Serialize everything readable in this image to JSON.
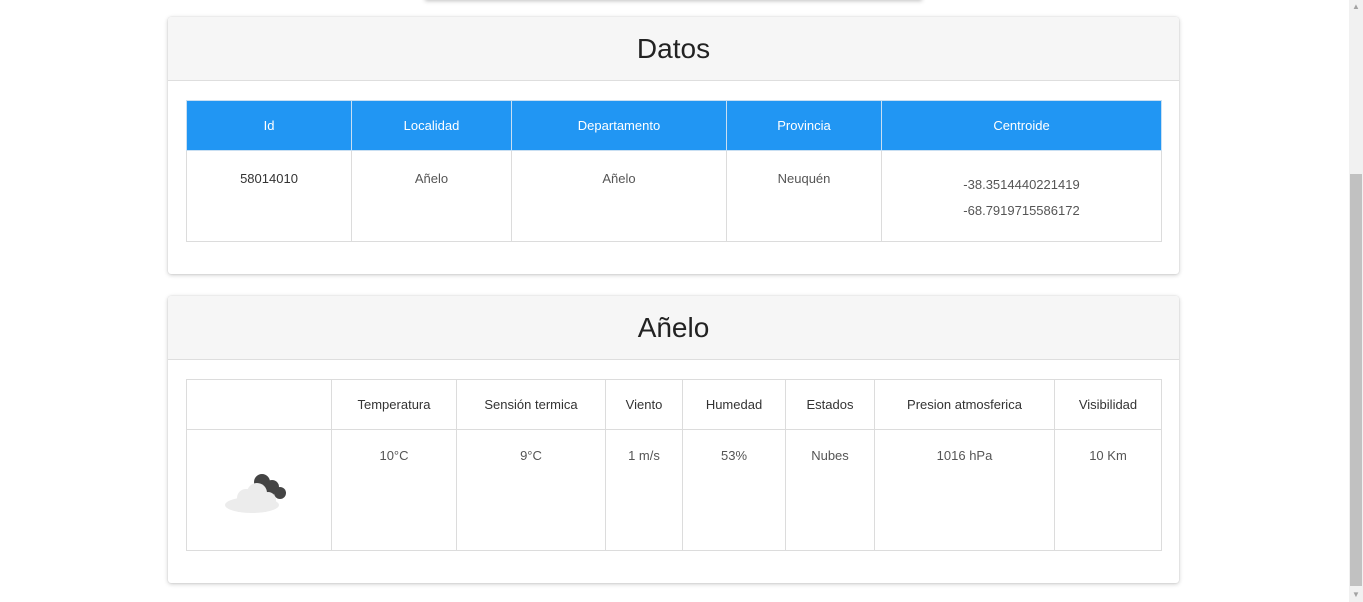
{
  "datos_card": {
    "title": "Datos",
    "columns": [
      "Id",
      "Localidad",
      "Departamento",
      "Provincia",
      "Centroide"
    ],
    "row": {
      "id": "58014010",
      "localidad": "Añelo",
      "departamento": "Añelo",
      "provincia": "Neuquén",
      "centroide_lat": "-38.3514440221419",
      "centroide_lon": "-68.7919715586172"
    }
  },
  "weather_card": {
    "title": "Añelo",
    "columns": [
      "",
      "Temperatura",
      "Sensión termica",
      "Viento",
      "Humedad",
      "Estados",
      "Presion atmosferica",
      "Visibilidad"
    ],
    "row": {
      "icon": "cloud-icon",
      "temperatura": "10°C",
      "sensacion": "9°C",
      "viento": "1 m/s",
      "humedad": "53%",
      "estado": "Nubes",
      "presion": "1016 hPa",
      "visibilidad": "10 Km"
    }
  },
  "colors": {
    "header_blue": "#2196f3",
    "card_header_bg": "#f6f6f6"
  }
}
